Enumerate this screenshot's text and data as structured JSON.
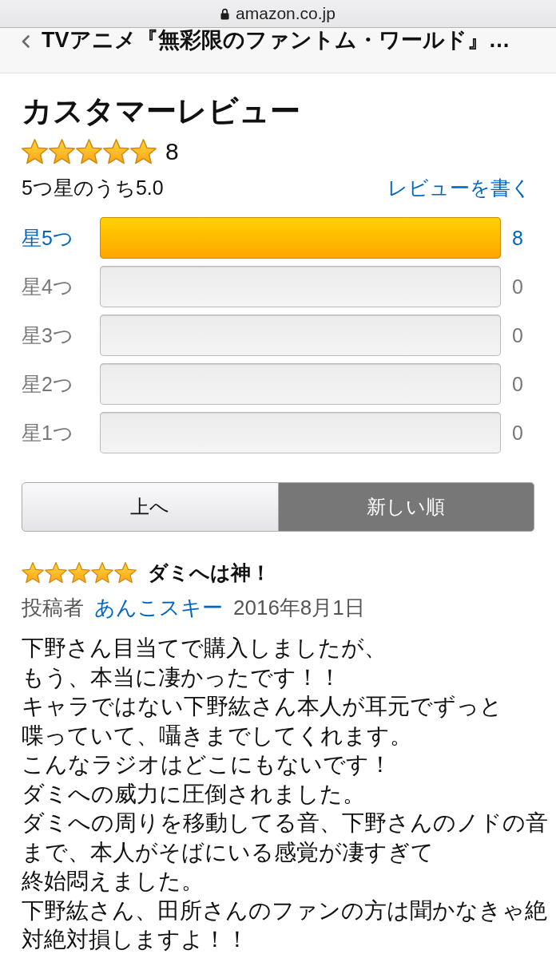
{
  "browser": {
    "url": "amazon.co.jp"
  },
  "nav_bar": {
    "title": "TVアニメ『無彩限のファントム・ワールド』…"
  },
  "reviews_summary": {
    "heading": "カスタマーレビュー",
    "stars": 5,
    "rating_count": "8",
    "average": "5つ星のうち5.0",
    "write_review_link": "レビューを書く"
  },
  "histogram": [
    {
      "label": "星5つ",
      "level": 1,
      "count": "8",
      "disabled": false
    },
    {
      "label": "星4つ",
      "count": "0",
      "disabled": true
    },
    {
      "label": "星3つ",
      "count": "0",
      "disabled": true
    },
    {
      "label": "星2つ",
      "count": "0",
      "disabled": true
    },
    {
      "label": "星1つ",
      "count": "0",
      "disabled": true
    }
  ],
  "sort_options": [
    {
      "label": "上へ",
      "selected": false
    },
    {
      "label": "新しい順",
      "selected": true
    }
  ],
  "reviews": [
    {
      "stars": 5,
      "title": "ダミへは神！",
      "byline_label": "投稿者",
      "author": "あんこスキー",
      "date": "2016年8月1日",
      "paragraphs": [
        "下野さん目当てで購入しましたが、",
        "もう、本当に凄かったです！！",
        "キャラではない下野紘さん本人が耳元でずっと",
        "喋っていて、囁きまでしてくれます。",
        "こんなラジオはどこにもないです！",
        "ダミへの威力に圧倒されました。",
        "ダミへの周りを移動してる音、下野さんのノドの音まで、本人がそばにいる感覚が凄すぎて",
        "終始悶えました。",
        "下野紘さん、田所さんのファンの方は聞かなきゃ絶対絶対損しますよ！！"
      ]
    }
  ]
}
